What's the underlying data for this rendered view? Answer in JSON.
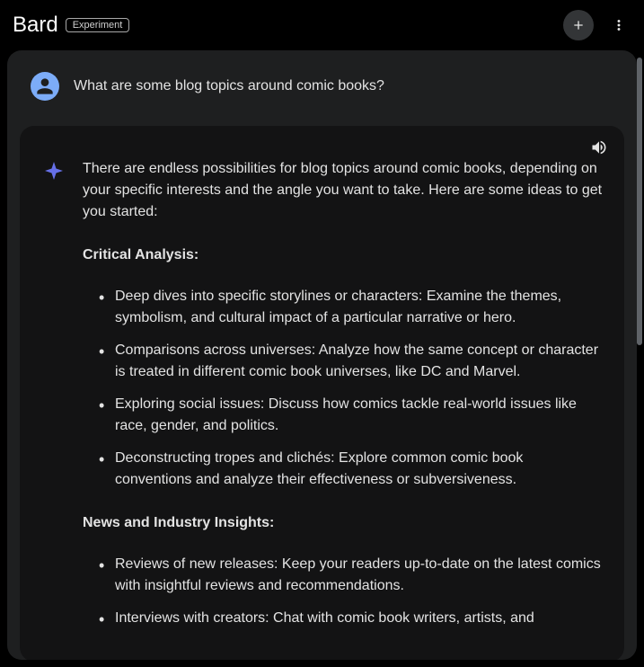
{
  "header": {
    "brand": "Bard",
    "badge": "Experiment"
  },
  "user_message": {
    "text": "What are some blog topics around comic books?"
  },
  "response": {
    "intro": "There are endless possibilities for blog topics around comic books, depending on your specific interests and the angle you want to take. Here are some ideas to get you started:",
    "sections": [
      {
        "heading": "Critical Analysis:",
        "items": [
          "Deep dives into specific storylines or characters: Examine the themes, symbolism, and cultural impact of a particular narrative or hero.",
          "Comparisons across universes: Analyze how the same concept or character is treated in different comic book universes, like DC and Marvel.",
          "Exploring social issues: Discuss how comics tackle real-world issues like race, gender, and politics.",
          "Deconstructing tropes and clichés: Explore common comic book conventions and analyze their effectiveness or subversiveness."
        ]
      },
      {
        "heading": "News and Industry Insights:",
        "items": [
          "Reviews of new releases: Keep your readers up-to-date on the latest comics with insightful reviews and recommendations.",
          "Interviews with creators: Chat with comic book writers, artists, and"
        ]
      }
    ]
  }
}
